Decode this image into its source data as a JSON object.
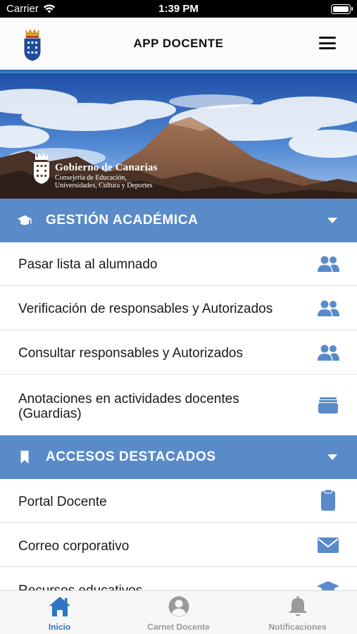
{
  "status_bar": {
    "carrier": "Carrier",
    "time": "1:39 PM"
  },
  "header": {
    "title": "APP DOCENTE"
  },
  "banner": {
    "org": "Gobierno de Canarias",
    "sub_line1": "Consejería de Educación,",
    "sub_line2": "Universidades, Cultura y Deportes"
  },
  "sections": [
    {
      "label": "GESTIÓN ACADÉMICA",
      "icon": "graduation-cap-icon",
      "items": [
        {
          "label": "Pasar lista al alumnado",
          "icon": "users-icon"
        },
        {
          "label": "Verificación de responsables y Autorizados",
          "icon": "users-icon"
        },
        {
          "label": "Consultar responsables y Autorizados",
          "icon": "users-icon"
        },
        {
          "label_line1": "Anotaciones en actividades docentes",
          "label_line2": "(Guardias)",
          "icon": "archive-icon"
        }
      ]
    },
    {
      "label": "ACCESOS DESTACADOS",
      "icon": "bookmark-icon",
      "items": [
        {
          "label": "Portal Docente",
          "icon": "clipboard-icon"
        },
        {
          "label": "Correo corporativo",
          "icon": "envelope-icon"
        },
        {
          "label": "Recursos educativos",
          "icon": "graduation-cap-icon"
        }
      ]
    }
  ],
  "tabs": [
    {
      "label": "Inicio",
      "icon": "home-icon",
      "active": true
    },
    {
      "label": "Carnet Docente",
      "icon": "user-circle-icon",
      "active": false
    },
    {
      "label": "Notificaciones",
      "icon": "bell-icon",
      "active": false
    }
  ],
  "colors": {
    "accent": "#5a8bc9",
    "icon_blue": "#5a8bc9",
    "active_tab": "#2e75c4",
    "inactive_tab": "#9a9a9a"
  }
}
